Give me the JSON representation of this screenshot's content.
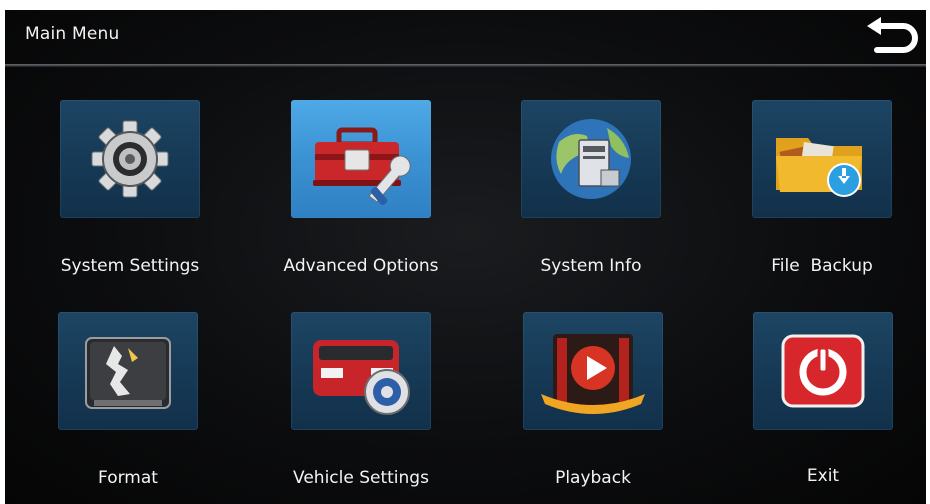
{
  "header": {
    "title": "Main Menu"
  },
  "menu": {
    "items": [
      {
        "label": "System Settings",
        "icon": "gear-icon",
        "selected": false
      },
      {
        "label": "Advanced Options",
        "icon": "toolbox-icon",
        "selected": true
      },
      {
        "label": "System Info",
        "icon": "globe-computer-icon",
        "selected": false
      },
      {
        "label": "File  Backup",
        "icon": "folder-download-icon",
        "selected": false
      },
      {
        "label": "Format",
        "icon": "hard-drive-icon",
        "selected": false
      },
      {
        "label": "Vehicle Settings",
        "icon": "vehicle-gear-icon",
        "selected": false
      },
      {
        "label": "Playback",
        "icon": "film-play-icon",
        "selected": false
      },
      {
        "label": "Exit",
        "icon": "power-icon",
        "selected": false
      }
    ]
  },
  "colors": {
    "tile": "#1d4563",
    "tile_selected": "#4fa9e6",
    "background": "#0c0d0f",
    "text": "#f4f4f4"
  }
}
